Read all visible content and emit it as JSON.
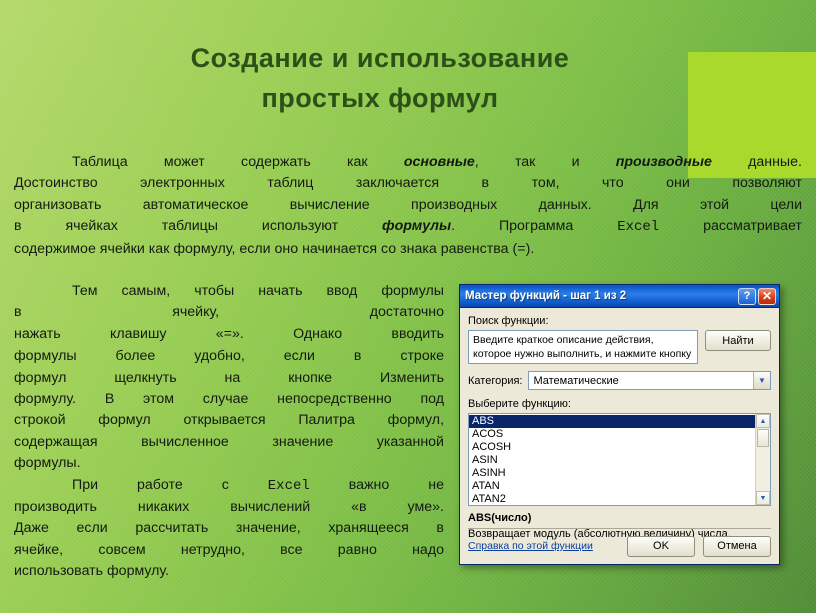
{
  "slide": {
    "title_lines": [
      "Создание  и  использование",
      "простых  формул"
    ],
    "background_gradient_from": "#b4d96a",
    "background_gradient_to": "#4f8b34",
    "accent_rect_color": "#a9d92c",
    "title_color": "#2d5019"
  },
  "paragraph_top": {
    "lines": [
      {
        "indent": true,
        "parts": [
          {
            "t": "Таблица может содержать как ",
            "s": "n"
          },
          {
            "t": "основные",
            "s": "bi"
          },
          {
            "t": ", так и ",
            "s": "n"
          },
          {
            "t": "производные",
            "s": "bi"
          },
          {
            "t": " данные.",
            "s": "n"
          }
        ]
      },
      {
        "indent": false,
        "parts": [
          {
            "t": "Достоинство электронных таблиц заключается в том, что они позволяют",
            "s": "n"
          }
        ]
      },
      {
        "indent": false,
        "parts": [
          {
            "t": "организовать автоматическое вычисление производных данных. Для этой цели",
            "s": "n"
          }
        ]
      },
      {
        "indent": false,
        "parts": [
          {
            "t": "в ячейках таблицы используют ",
            "s": "n"
          },
          {
            "t": "формулы",
            "s": "bi"
          },
          {
            "t": ". Программа ",
            "s": "n"
          },
          {
            "t": "Excel",
            "s": "mono"
          },
          {
            "t": " рассматривает",
            "s": "n"
          }
        ]
      },
      {
        "indent": false,
        "last": true,
        "parts": [
          {
            "t": "содержимое ячейки как формулу, если оно начинается со знака равенства (",
            "s": "n"
          },
          {
            "t": "=",
            "s": "mono"
          },
          {
            "t": ").",
            "s": "n"
          }
        ]
      }
    ]
  },
  "paragraph_left": {
    "lines": [
      {
        "indent": true,
        "parts": [
          {
            "t": "Тем самым, чтобы начать ввод формулы",
            "s": "n"
          }
        ]
      },
      {
        "indent": false,
        "parts": [
          {
            "t": "в ячейку, достаточно",
            "s": "n"
          }
        ]
      },
      {
        "indent": false,
        "parts": [
          {
            "t": "нажать клавишу «",
            "s": "n"
          },
          {
            "t": "=",
            "s": "mono"
          },
          {
            "t": "». Однако вводить",
            "s": "n"
          }
        ]
      },
      {
        "indent": false,
        "parts": [
          {
            "t": "формулы более удобно, если в строке",
            "s": "n"
          }
        ]
      },
      {
        "indent": false,
        "parts": [
          {
            "t": "формул щелкнуть на кнопке Изменить",
            "s": "n"
          }
        ]
      },
      {
        "indent": false,
        "parts": [
          {
            "t": "формулу. В этом случае непосредственно под",
            "s": "n"
          }
        ]
      },
      {
        "indent": false,
        "parts": [
          {
            "t": "строкой формул открывается Палитра формул,",
            "s": "n"
          }
        ]
      },
      {
        "indent": false,
        "parts": [
          {
            "t": "содержащая вычисленное значение указанной",
            "s": "n"
          }
        ]
      },
      {
        "indent": false,
        "last": true,
        "parts": [
          {
            "t": "формулы.",
            "s": "n"
          }
        ]
      },
      {
        "indent": true,
        "parts": [
          {
            "t": "При работе с ",
            "s": "n"
          },
          {
            "t": "Excel",
            "s": "mono"
          },
          {
            "t": " важно не",
            "s": "n"
          }
        ]
      },
      {
        "indent": false,
        "parts": [
          {
            "t": "производить никаких вычислений «в уме».",
            "s": "n"
          }
        ]
      },
      {
        "indent": false,
        "parts": [
          {
            "t": "Даже если рассчитать значение, хранящееся в",
            "s": "n"
          }
        ]
      },
      {
        "indent": false,
        "parts": [
          {
            "t": "ячейке, совсем нетрудно, все равно надо",
            "s": "n"
          }
        ]
      },
      {
        "indent": false,
        "last": true,
        "parts": [
          {
            "t": "использовать формулу.",
            "s": "n"
          }
        ]
      }
    ]
  },
  "dialog": {
    "title": "Мастер функций - шаг 1 из 2",
    "help_button": "?",
    "close_button": "✕",
    "search_label": "Поиск функции:",
    "search_value": "Введите краткое описание действия, которое нужно выполнить, и нажмите кнопку \"Найти\"",
    "find_button": "Найти",
    "category_label": "Категория:",
    "category_value": "Математические",
    "category_arrow": "▼",
    "function_label": "Выберите функцию:",
    "functions": [
      "ABS",
      "ACOS",
      "ACOSH",
      "ASIN",
      "ASINH",
      "ATAN",
      "ATAN2"
    ],
    "selected_function": "ABS",
    "scroll_up": "▲",
    "scroll_down": "▼",
    "description_signature": "ABS(число)",
    "description_text": "Возвращает модуль (абсолютную величину) числа.",
    "help_link": "Справка по этой функции",
    "ok_button": "OK",
    "cancel_button": "Отмена"
  }
}
